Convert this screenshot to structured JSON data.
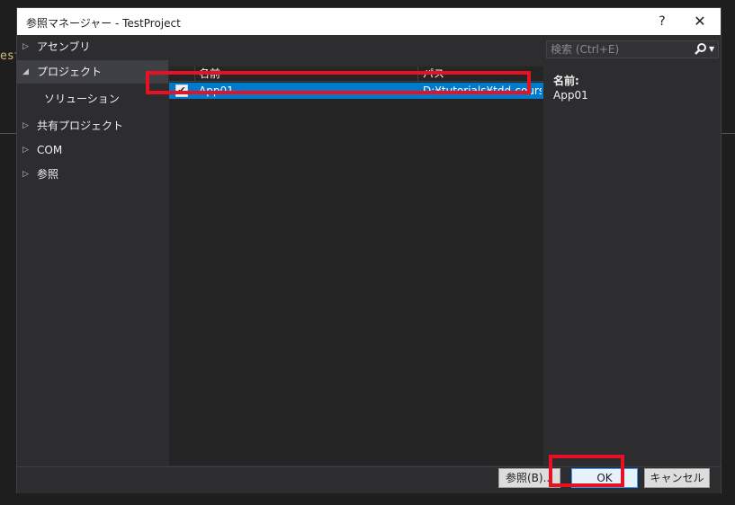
{
  "background": {
    "editor_text": "est"
  },
  "dialog": {
    "title": "参照マネージャー - TestProject",
    "help_label": "?",
    "close_label": "✕"
  },
  "sidebar": {
    "items": [
      {
        "label": "アセンブリ",
        "expander": "▷"
      },
      {
        "label": "プロジェクト",
        "expander": "◢"
      },
      {
        "label": "ソリューション"
      },
      {
        "label": "共有プロジェクト",
        "expander": "▷"
      },
      {
        "label": "COM",
        "expander": "▷"
      },
      {
        "label": "参照",
        "expander": "▷"
      }
    ]
  },
  "list": {
    "columns": {
      "name": "名前",
      "path": "パス"
    },
    "rows": [
      {
        "checked": "✔",
        "name": "App01",
        "path": "D:¥tutorials¥tdd-cours..."
      }
    ]
  },
  "search": {
    "placeholder": "検索 (Ctrl+E)",
    "icon": "search-icon",
    "dropdown": "▼"
  },
  "details": {
    "name_label": "名前:",
    "name_value": "App01"
  },
  "footer": {
    "browse_label": "参照(B)...",
    "ok_label": "OK",
    "cancel_label": "キャンセル"
  },
  "colors": {
    "selection": "#007acc",
    "highlight": "#e81123",
    "dialog_bg": "#2d2d30"
  }
}
